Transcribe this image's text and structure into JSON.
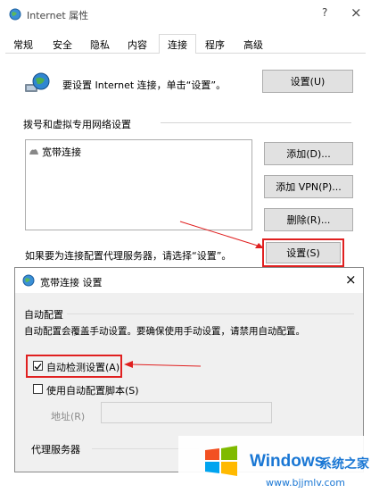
{
  "window": {
    "title": "Internet 属性",
    "help": "?",
    "close": "×"
  },
  "tabs": [
    {
      "label": "常规"
    },
    {
      "label": "安全"
    },
    {
      "label": "隐私"
    },
    {
      "label": "内容"
    },
    {
      "label": "连接"
    },
    {
      "label": "程序"
    },
    {
      "label": "高级"
    }
  ],
  "connections": {
    "setup_text": "要设置 Internet 连接，单击“设置”。",
    "setup_button": "设置(U)",
    "dialup_heading": "拨号和虚拟专用网络设置",
    "list_items": [
      "宽带连接"
    ],
    "add_button": "添加(D)...",
    "add_vpn_button": "添加 VPN(P)...",
    "delete_button": "删除(R)...",
    "proxy_text": "如果要为连接配置代理服务器，请选择“设置”。",
    "settings_button": "设置(S)"
  },
  "dialog": {
    "title": "宽带连接 设置",
    "close": "×",
    "auto_config_heading": "自动配置",
    "auto_config_desc": "自动配置会覆盖手动设置。要确保使用手动设置，请禁用自动配置。",
    "auto_detect_label": "自动检测设置(A)",
    "auto_detect_checked": true,
    "auto_script_label": "使用自动配置脚本(S)",
    "auto_script_checked": false,
    "address_label": "地址(R)",
    "address_value": "",
    "proxy_heading": "代理服务器"
  },
  "watermark": {
    "brand": "Windows",
    "brand_cn": "系统之家",
    "url": "www.bjjmlv.com"
  },
  "colors": {
    "annotation_red": "#e02020",
    "button_face": "#e1e1e1",
    "windows_blue": "#1a77d4"
  }
}
